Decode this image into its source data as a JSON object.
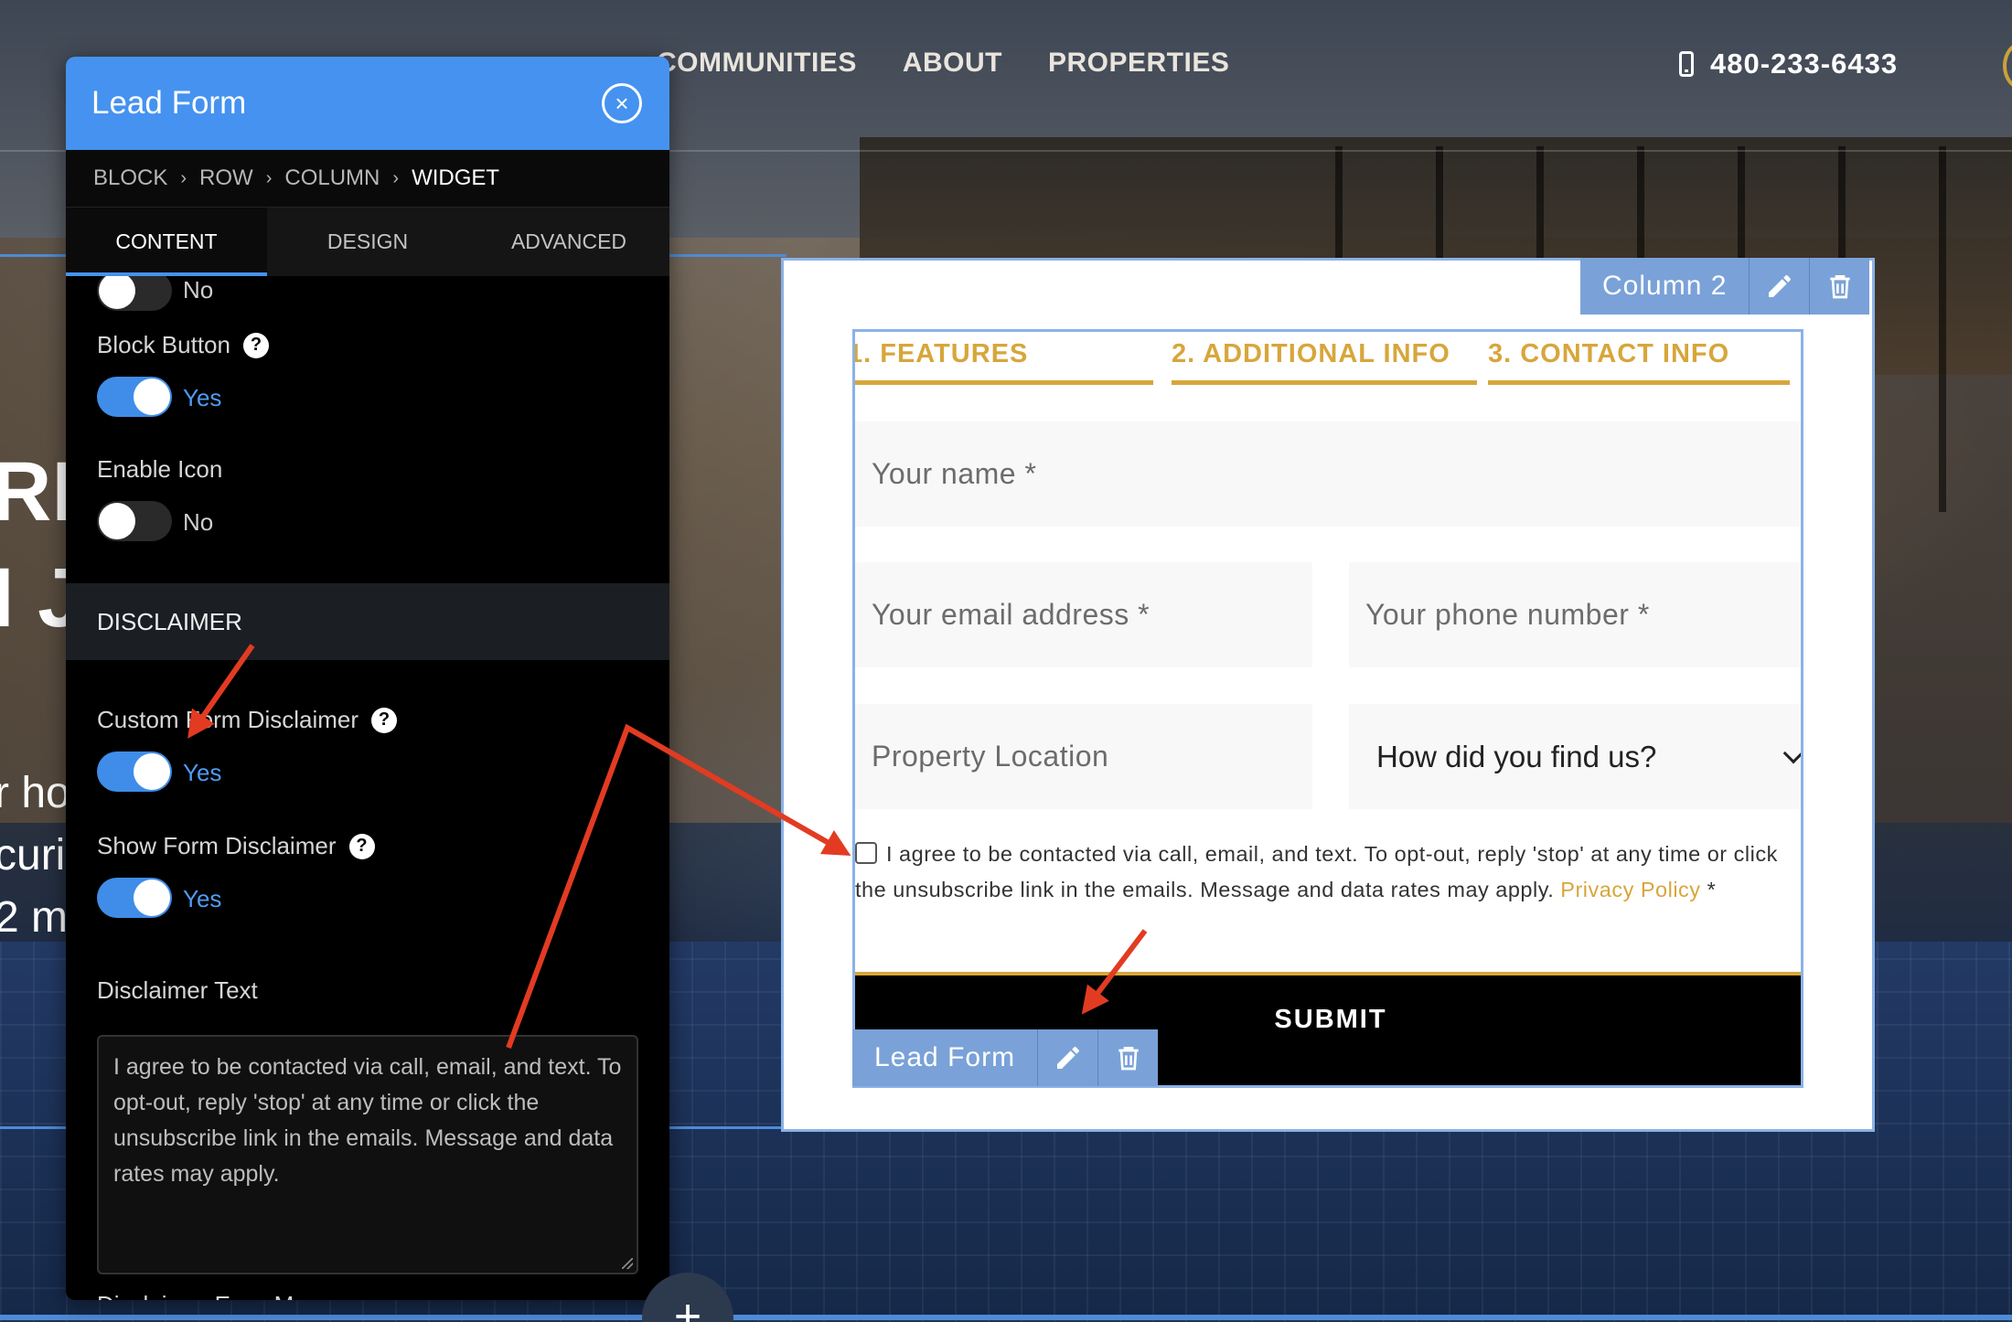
{
  "nav": {
    "items": [
      "COMMUNITIES",
      "ABOUT",
      "PROPERTIES"
    ],
    "phone": "480-233-6433"
  },
  "hero": {
    "fragments": [
      "RE",
      "I J",
      "r ho",
      "curi",
      "2 m"
    ]
  },
  "panel": {
    "title": "Lead Form",
    "breadcrumbs": [
      "BLOCK",
      "ROW",
      "COLUMN",
      "WIDGET"
    ],
    "tabs": [
      "CONTENT",
      "DESIGN",
      "ADVANCED"
    ],
    "active_tab": "CONTENT",
    "top_toggle": {
      "value": "No"
    },
    "block_button": {
      "label": "Block Button",
      "value": "Yes"
    },
    "enable_icon": {
      "label": "Enable Icon",
      "value": "No"
    },
    "disclaimer_section": "DISCLAIMER",
    "custom_disclaimer": {
      "label": "Custom Form Disclaimer",
      "value": "Yes"
    },
    "show_disclaimer": {
      "label": "Show Form Disclaimer",
      "value": "Yes"
    },
    "disclaimer_text": {
      "label": "Disclaimer Text",
      "value": "I agree to be contacted via call, email, and text. To opt-out, reply 'stop' at any time or click the unsubscribe link in the emails. Message and data rates may apply."
    },
    "error_message_label": "Disclaimer Error Message"
  },
  "column": {
    "label": "Column 2"
  },
  "form": {
    "steps": [
      "1. FEATURES",
      "2. ADDITIONAL INFO",
      "3. CONTACT INFO"
    ],
    "name_placeholder": "Your name *",
    "email_placeholder": "Your email address *",
    "phone_placeholder": "Your phone number *",
    "location_placeholder": "Property Location",
    "source_select": "How did you find us?",
    "consent_text": "I agree to be contacted via call, email, and text. To opt-out, reply 'stop' at any time or click the unsubscribe link in the emails. Message and data rates may apply.",
    "privacy_link": "Privacy Policy",
    "required_mark": "*",
    "submit_label": "SUBMIT",
    "widget_label": "Lead Form"
  },
  "colors": {
    "panel_header": "#4592f0",
    "toggle_on": "#3f8de8",
    "accent_gold": "#d7a63b",
    "tool_blue": "#7aa2d8",
    "annotation_red": "#e23b22"
  }
}
